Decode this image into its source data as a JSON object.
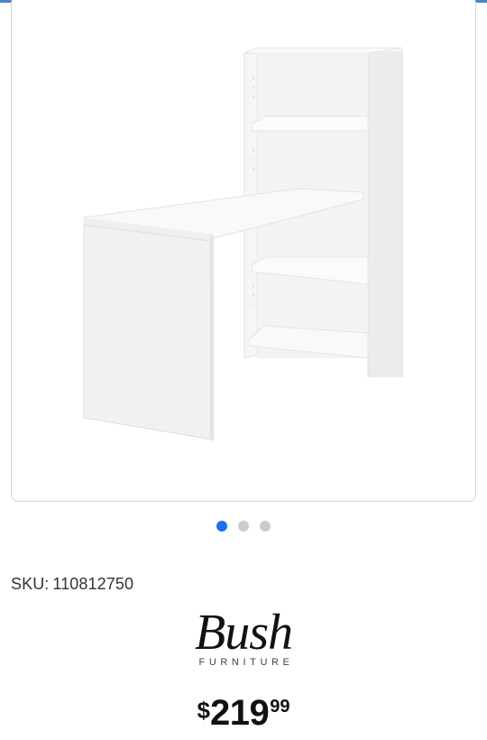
{
  "product": {
    "image_alt": "Bush Furniture white desk with bookcase",
    "sku_label": "SKU:",
    "sku_value": "110812750"
  },
  "carousel": {
    "total": 3,
    "active_index": 0
  },
  "brand": {
    "name": "Bush",
    "subtitle": "FURNITURE"
  },
  "price": {
    "currency": "$",
    "dollars": "219",
    "cents": "99"
  },
  "colors": {
    "accent": "#1a73e8",
    "dot_inactive": "#c9cbcd",
    "card_border": "#d4d6d9"
  }
}
